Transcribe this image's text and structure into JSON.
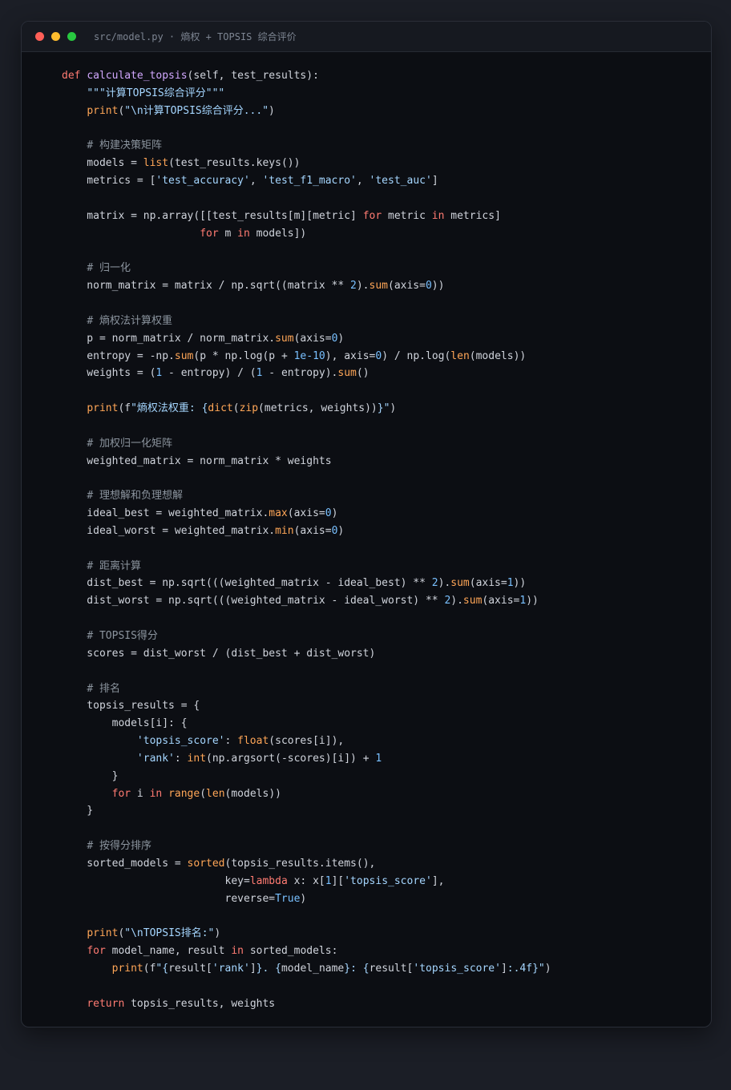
{
  "window": {
    "title": "src/model.py · 熵权 + TOPSIS 综合评价"
  },
  "colors": {
    "background": "#1b1e26",
    "editor_bg": "#0c0e13",
    "keyword": "#ff7b72",
    "function_name": "#d2a8ff",
    "builtin": "#ffa657",
    "string": "#a5d6ff",
    "number": "#79c0ff",
    "comment": "#8b949e",
    "text": "#d0d4dc"
  },
  "code": {
    "language": "python",
    "lines": [
      [
        [
          "kw",
          "def "
        ],
        [
          "fn",
          "calculate_topsis"
        ],
        [
          "t",
          "(self, test_results):"
        ]
      ],
      [
        [
          "t",
          "    "
        ],
        [
          "str",
          "\"\"\"计算TOPSIS综合评分\"\"\""
        ]
      ],
      [
        [
          "t",
          "    "
        ],
        [
          "bi",
          "print"
        ],
        [
          "t",
          "("
        ],
        [
          "str",
          "\"\\n计算TOPSIS综合评分...\""
        ],
        [
          "t",
          ")"
        ]
      ],
      [],
      [
        [
          "t",
          "    "
        ],
        [
          "cm",
          "# 构建决策矩阵"
        ]
      ],
      [
        [
          "t",
          "    models = "
        ],
        [
          "bi",
          "list"
        ],
        [
          "t",
          "(test_results.keys())"
        ]
      ],
      [
        [
          "t",
          "    metrics = ["
        ],
        [
          "str",
          "'test_accuracy'"
        ],
        [
          "t",
          ", "
        ],
        [
          "str",
          "'test_f1_macro'"
        ],
        [
          "t",
          ", "
        ],
        [
          "str",
          "'test_auc'"
        ],
        [
          "t",
          "]"
        ]
      ],
      [],
      [
        [
          "t",
          "    matrix = np.array([[test_results[m][metric] "
        ],
        [
          "kw",
          "for"
        ],
        [
          "t",
          " metric "
        ],
        [
          "kw",
          "in"
        ],
        [
          "t",
          " metrics]"
        ]
      ],
      [
        [
          "t",
          "                      "
        ],
        [
          "kw",
          "for"
        ],
        [
          "t",
          " m "
        ],
        [
          "kw",
          "in"
        ],
        [
          "t",
          " models])"
        ]
      ],
      [],
      [
        [
          "t",
          "    "
        ],
        [
          "cm",
          "# 归一化"
        ]
      ],
      [
        [
          "t",
          "    norm_matrix = matrix / np.sqrt((matrix ** "
        ],
        [
          "num",
          "2"
        ],
        [
          "t",
          ")."
        ],
        [
          "bi",
          "sum"
        ],
        [
          "t",
          "(axis="
        ],
        [
          "num",
          "0"
        ],
        [
          "t",
          "))"
        ]
      ],
      [],
      [
        [
          "t",
          "    "
        ],
        [
          "cm",
          "# 熵权法计算权重"
        ]
      ],
      [
        [
          "t",
          "    p = norm_matrix / norm_matrix."
        ],
        [
          "bi",
          "sum"
        ],
        [
          "t",
          "(axis="
        ],
        [
          "num",
          "0"
        ],
        [
          "t",
          ")"
        ]
      ],
      [
        [
          "t",
          "    entropy = -np."
        ],
        [
          "bi",
          "sum"
        ],
        [
          "t",
          "(p * np.log(p + "
        ],
        [
          "num",
          "1e-10"
        ],
        [
          "t",
          "), axis="
        ],
        [
          "num",
          "0"
        ],
        [
          "t",
          ") / np.log("
        ],
        [
          "bi",
          "len"
        ],
        [
          "t",
          "(models))"
        ]
      ],
      [
        [
          "t",
          "    weights = ("
        ],
        [
          "num",
          "1"
        ],
        [
          "t",
          " - entropy) / ("
        ],
        [
          "num",
          "1"
        ],
        [
          "t",
          " - entropy)."
        ],
        [
          "bi",
          "sum"
        ],
        [
          "t",
          "()"
        ]
      ],
      [],
      [
        [
          "t",
          "    "
        ],
        [
          "bi",
          "print"
        ],
        [
          "t",
          "(f"
        ],
        [
          "str",
          "\"熵权法权重: {"
        ],
        [
          "bi",
          "dict"
        ],
        [
          "t",
          "("
        ],
        [
          "bi",
          "zip"
        ],
        [
          "t",
          "(metrics, weights))"
        ],
        [
          "str",
          "}\""
        ],
        [
          "t",
          ")"
        ]
      ],
      [],
      [
        [
          "t",
          "    "
        ],
        [
          "cm",
          "# 加权归一化矩阵"
        ]
      ],
      [
        [
          "t",
          "    weighted_matrix = norm_matrix * weights"
        ]
      ],
      [],
      [
        [
          "t",
          "    "
        ],
        [
          "cm",
          "# 理想解和负理想解"
        ]
      ],
      [
        [
          "t",
          "    ideal_best = weighted_matrix."
        ],
        [
          "bi",
          "max"
        ],
        [
          "t",
          "(axis="
        ],
        [
          "num",
          "0"
        ],
        [
          "t",
          ")"
        ]
      ],
      [
        [
          "t",
          "    ideal_worst = weighted_matrix."
        ],
        [
          "bi",
          "min"
        ],
        [
          "t",
          "(axis="
        ],
        [
          "num",
          "0"
        ],
        [
          "t",
          ")"
        ]
      ],
      [],
      [
        [
          "t",
          "    "
        ],
        [
          "cm",
          "# 距离计算"
        ]
      ],
      [
        [
          "t",
          "    dist_best = np.sqrt(((weighted_matrix - ideal_best) ** "
        ],
        [
          "num",
          "2"
        ],
        [
          "t",
          ")."
        ],
        [
          "bi",
          "sum"
        ],
        [
          "t",
          "(axis="
        ],
        [
          "num",
          "1"
        ],
        [
          "t",
          "))"
        ]
      ],
      [
        [
          "t",
          "    dist_worst = np.sqrt(((weighted_matrix - ideal_worst) ** "
        ],
        [
          "num",
          "2"
        ],
        [
          "t",
          ")."
        ],
        [
          "bi",
          "sum"
        ],
        [
          "t",
          "(axis="
        ],
        [
          "num",
          "1"
        ],
        [
          "t",
          "))"
        ]
      ],
      [],
      [
        [
          "t",
          "    "
        ],
        [
          "cm",
          "# TOPSIS得分"
        ]
      ],
      [
        [
          "t",
          "    scores = dist_worst / (dist_best + dist_worst)"
        ]
      ],
      [],
      [
        [
          "t",
          "    "
        ],
        [
          "cm",
          "# 排名"
        ]
      ],
      [
        [
          "t",
          "    topsis_results = {"
        ]
      ],
      [
        [
          "t",
          "        models[i]: {"
        ]
      ],
      [
        [
          "t",
          "            "
        ],
        [
          "str",
          "'topsis_score'"
        ],
        [
          "t",
          ": "
        ],
        [
          "bi",
          "float"
        ],
        [
          "t",
          "(scores[i]),"
        ]
      ],
      [
        [
          "t",
          "            "
        ],
        [
          "str",
          "'rank'"
        ],
        [
          "t",
          ": "
        ],
        [
          "bi",
          "int"
        ],
        [
          "t",
          "(np.argsort(-scores)[i]) + "
        ],
        [
          "num",
          "1"
        ]
      ],
      [
        [
          "t",
          "        }"
        ]
      ],
      [
        [
          "t",
          "        "
        ],
        [
          "kw",
          "for"
        ],
        [
          "t",
          " i "
        ],
        [
          "kw",
          "in"
        ],
        [
          "t",
          " "
        ],
        [
          "bi",
          "range"
        ],
        [
          "t",
          "("
        ],
        [
          "bi",
          "len"
        ],
        [
          "t",
          "(models))"
        ]
      ],
      [
        [
          "t",
          "    }"
        ]
      ],
      [],
      [
        [
          "t",
          "    "
        ],
        [
          "cm",
          "# 按得分排序"
        ]
      ],
      [
        [
          "t",
          "    sorted_models = "
        ],
        [
          "bi",
          "sorted"
        ],
        [
          "t",
          "(topsis_results.items(),"
        ]
      ],
      [
        [
          "t",
          "                          key="
        ],
        [
          "kw",
          "lambda"
        ],
        [
          "t",
          " x: x["
        ],
        [
          "num",
          "1"
        ],
        [
          "t",
          "]["
        ],
        [
          "str",
          "'topsis_score'"
        ],
        [
          "t",
          "],"
        ]
      ],
      [
        [
          "t",
          "                          reverse="
        ],
        [
          "num",
          "True"
        ],
        [
          "t",
          ")"
        ]
      ],
      [],
      [
        [
          "t",
          "    "
        ],
        [
          "bi",
          "print"
        ],
        [
          "t",
          "("
        ],
        [
          "str",
          "\"\\nTOPSIS排名:\""
        ],
        [
          "t",
          ")"
        ]
      ],
      [
        [
          "t",
          "    "
        ],
        [
          "kw",
          "for"
        ],
        [
          "t",
          " model_name, result "
        ],
        [
          "kw",
          "in"
        ],
        [
          "t",
          " sorted_models:"
        ]
      ],
      [
        [
          "t",
          "        "
        ],
        [
          "bi",
          "print"
        ],
        [
          "t",
          "(f"
        ],
        [
          "str",
          "\"{"
        ],
        [
          "t",
          "result["
        ],
        [
          "str",
          "'rank'"
        ],
        [
          "t",
          "]"
        ],
        [
          "str",
          "}. {"
        ],
        [
          "t",
          "model_name"
        ],
        [
          "str",
          "}: {"
        ],
        [
          "t",
          "result["
        ],
        [
          "str",
          "'topsis_score'"
        ],
        [
          "t",
          "]"
        ],
        [
          "str",
          ":.4f}\""
        ],
        [
          "t",
          ")"
        ]
      ],
      [],
      [
        [
          "t",
          "    "
        ],
        [
          "kw",
          "return"
        ],
        [
          "t",
          " topsis_results, weights"
        ]
      ]
    ]
  }
}
